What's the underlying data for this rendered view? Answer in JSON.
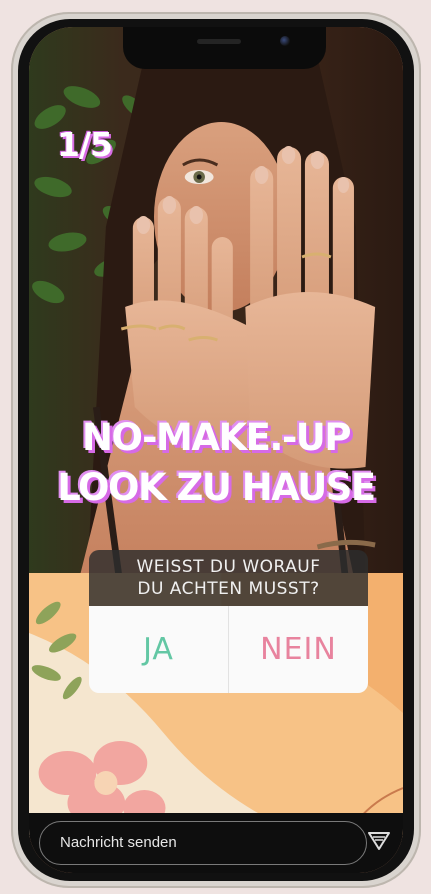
{
  "story": {
    "counter": "1/5",
    "headline_line1": "NO-MAKE.-UP",
    "headline_line2": "LOOK ZU HAUSE"
  },
  "poll": {
    "question_line1": "WEISST DU WORAUF",
    "question_line2": "DU ACHTEN MUSST?",
    "options": [
      "JA",
      "NEIN"
    ]
  },
  "reply": {
    "placeholder": "Nachricht senden"
  },
  "icons": {
    "send": "send-icon"
  },
  "colors": {
    "accent_pink": "#d86ce4",
    "poll_yes": "#63c7a4",
    "poll_no": "#e8839e"
  }
}
